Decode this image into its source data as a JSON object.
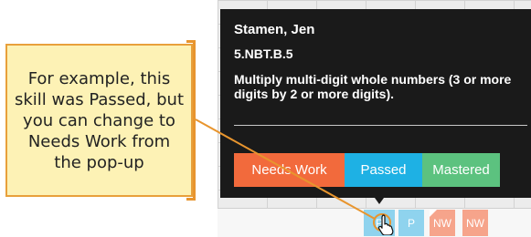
{
  "callout": {
    "text": "For example, this skill was Passed, but you can change to Needs Work from the pop-up"
  },
  "popup": {
    "student_name": "Stamen, Jen",
    "standard_code": "5.NBT.B.5",
    "description": "Multiply multi-digit whole numbers (3 or more digits by 2 or more digits).",
    "buttons": [
      {
        "label": "Needs Work",
        "color": "#f26a3c"
      },
      {
        "label": "Passed",
        "color": "#1eb1e4"
      },
      {
        "label": "Mastered",
        "color": "#5cc27f"
      }
    ]
  },
  "cells": [
    {
      "label": "P",
      "color": "#8fd3ee"
    },
    {
      "label": "P",
      "color": "#8fd3ee"
    },
    {
      "label": "NW",
      "color": "#f6a48b"
    },
    {
      "label": "NW",
      "color": "#f6a48b"
    }
  ],
  "colors": {
    "callout_bg": "#fdf2b5",
    "callout_border": "#e8a03b",
    "popup_bg": "#1a1a1a"
  }
}
